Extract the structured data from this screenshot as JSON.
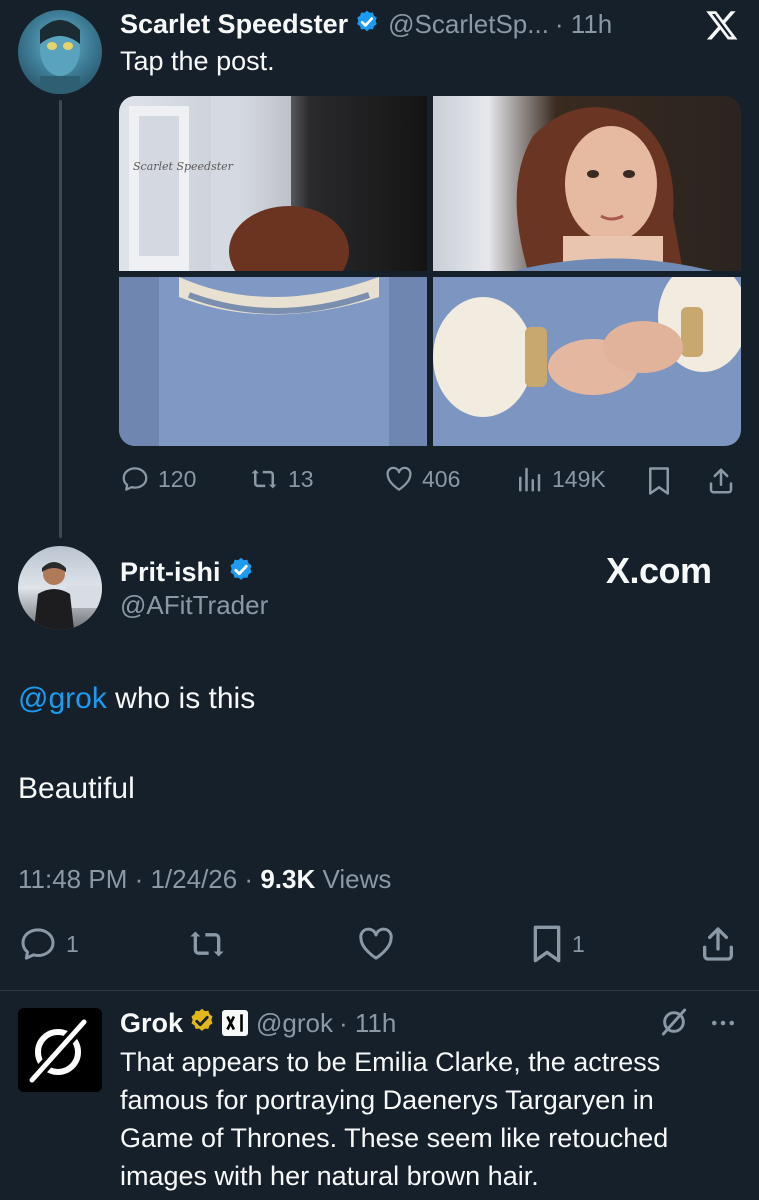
{
  "parent_post": {
    "author_name": "Scarlet Speedster",
    "handle": "@ScarletSp...",
    "time": "· 11h",
    "text": "Tap the post.",
    "watermark": "Scarlet Speedster",
    "stats": {
      "replies": "120",
      "reposts": "13",
      "likes": "406",
      "views": "149K"
    }
  },
  "main_post": {
    "author_name": "Prit-ishi",
    "handle": "@AFitTrader",
    "brand": "X.com",
    "mention": "@grok",
    "text_line1_rest": " who is this",
    "text_line2": "Beautiful",
    "timestamp": "11:48 PM · 1/24/26 ·",
    "views_count": "9.3K",
    "views_label": "Views",
    "stats": {
      "replies": "1",
      "bookmarks": "1"
    }
  },
  "reply": {
    "author_name": "Grok",
    "handle": "@grok",
    "time": "· 11h",
    "text_lines": [
      "That appears to be Emilia Clarke, the actress",
      "famous for portraying Daenerys Targaryen in",
      "Game of Thrones. These seem like retouched",
      "images with her natural brown hair."
    ]
  },
  "colors": {
    "background": "#15202b",
    "text": "#f7f9f9",
    "muted": "#8b98a5",
    "link": "#1d9bf0",
    "verified_blue": "#1d9bf0",
    "verified_gold": "#e2b719"
  },
  "icons": [
    "x-logo-icon",
    "verified-icon",
    "reply-icon",
    "repost-icon",
    "like-icon",
    "views-icon",
    "bookmark-icon",
    "share-icon",
    "grok-slash-icon",
    "more-icon",
    "xai-badge-icon"
  ]
}
